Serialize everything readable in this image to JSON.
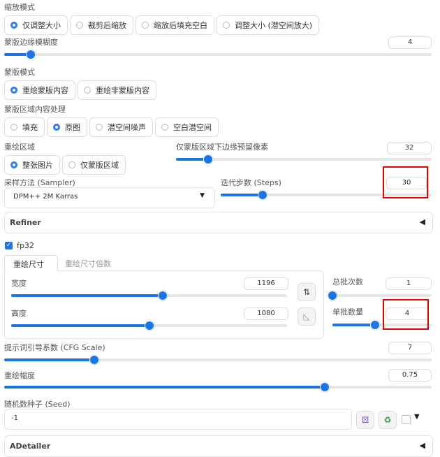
{
  "resize_mode": {
    "label": "缩放模式",
    "options": [
      "仅调整大小",
      "裁剪后缩放",
      "缩放后填充空白",
      "调整大小 (潜空间放大)"
    ],
    "selected": 0
  },
  "mask_blur": {
    "label": "蒙版边缘模糊度",
    "value": "4",
    "level": 0.062
  },
  "mask_mode": {
    "label": "蒙版模式",
    "options": [
      "重绘蒙版内容",
      "重绘非蒙版内容"
    ],
    "selected": 0
  },
  "masked_content": {
    "label": "蒙版区域内容处理",
    "options": [
      "填充",
      "原图",
      "潜空间噪声",
      "空白潜空间"
    ],
    "selected": 1
  },
  "inpaint_area": {
    "label": "重绘区域",
    "options": [
      "整张图片",
      "仅蒙版区域"
    ],
    "selected": 0
  },
  "padding": {
    "label": "仅蒙版区域下边缘预留像素",
    "value": "32",
    "level": 0.125
  },
  "sampler": {
    "label": "采样方法 (Sampler)",
    "value": "DPM++ 2M Karras"
  },
  "steps": {
    "label": "迭代步数 (Steps)",
    "value": "30",
    "level": 0.2
  },
  "refiner": {
    "label": "Refiner"
  },
  "fp32": {
    "label": "fp32",
    "checked": true
  },
  "size_tabs": [
    "重绘尺寸",
    "重绘尺寸倍数"
  ],
  "width": {
    "label": "宽度",
    "value": "1196",
    "level": 0.55
  },
  "height": {
    "label": "高度",
    "value": "1080",
    "level": 0.5
  },
  "batch_count": {
    "label": "总批次数",
    "value": "1",
    "level": 0.0
  },
  "batch_size": {
    "label": "单批数量",
    "value": "4",
    "level": 0.43
  },
  "cfg": {
    "label": "提示词引导系数 (CFG Scale)",
    "value": "7",
    "level": 0.21
  },
  "denoise": {
    "label": "重绘幅度",
    "value": "0.75",
    "level": 0.75
  },
  "seed": {
    "label": "随机数种子 (Seed)",
    "value": "-1"
  },
  "adetailer": {
    "label": "ADetailer"
  },
  "icons": {
    "swap": "swap-arrows-icon",
    "ratio": "ruler-triangle-icon",
    "dice": "dice-icon",
    "recycle": "recycle-icon"
  },
  "colors": {
    "accent": "#1b74e8",
    "highlight": "#e00000"
  }
}
